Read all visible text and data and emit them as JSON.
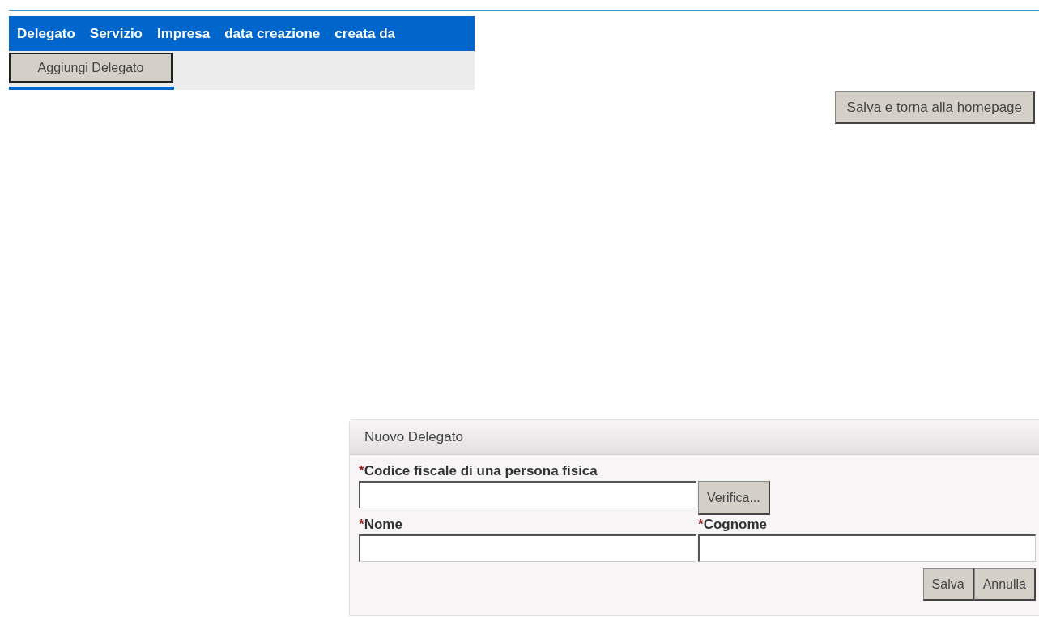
{
  "table": {
    "columns": [
      "Delegato",
      "Servizio",
      "Impresa",
      "data creazione",
      "creata da"
    ],
    "add_button": "Aggiungi Delegato"
  },
  "save_home_button": "Salva e torna alla homepage",
  "dialog": {
    "title": "Nuovo Delegato",
    "fields": [
      {
        "label": "Codice fiscale di una persona fisica",
        "required_mark": "*",
        "action": "Verifica..."
      },
      {
        "label": "Nome",
        "required_mark": "*"
      },
      {
        "label": "Cognome",
        "required_mark": "*"
      }
    ],
    "buttons": [
      "Salva",
      "Annulla"
    ]
  }
}
